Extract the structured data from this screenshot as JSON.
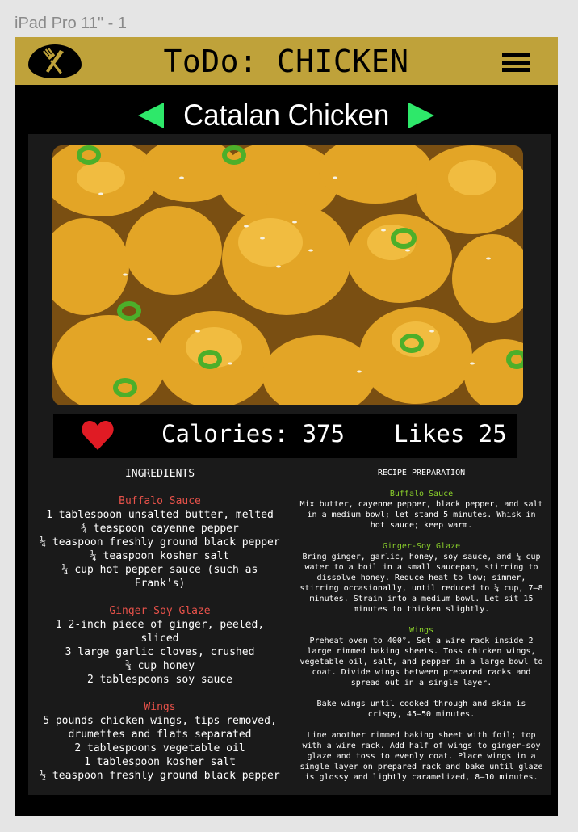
{
  "frame": {
    "label": "iPad Pro 11\" - 1"
  },
  "header": {
    "title": "ToDo: CHICKEN",
    "logo_icon": "fork-knife-icon",
    "menu_icon": "hamburger-menu-icon"
  },
  "colors": {
    "header_bg": "#bfa23a",
    "arrow": "#2ee86a",
    "heart": "#e01b24",
    "ingredient_section": "#e8524a",
    "prep_section": "#8bd12b"
  },
  "nav": {
    "recipe_title": "Catalan Chicken",
    "prev_icon": "left-arrow-icon",
    "next_icon": "right-arrow-icon"
  },
  "stats": {
    "heart_icon": "heart-icon",
    "calories": "Calories: 375",
    "likes": "Likes 25"
  },
  "ingredients": {
    "heading": "INGREDIENTS",
    "sections": [
      {
        "title": "Buffalo Sauce",
        "items": [
          "1 tablespoon unsalted butter, melted",
          "¾ teaspoon cayenne pepper",
          "¼ teaspoon freshly ground black pepper",
          "¼ teaspoon kosher salt",
          "¼ cup hot pepper sauce (such as Frank's)"
        ]
      },
      {
        "title": "Ginger-Soy Glaze",
        "items": [
          "1 2-inch piece of ginger, peeled, sliced",
          "3 large garlic cloves, crushed",
          "¾ cup honey",
          "2 tablespoons soy sauce"
        ]
      },
      {
        "title": "Wings",
        "items": [
          "5 pounds chicken wings, tips removed, drumettes and flats separated",
          "2 tablespoons vegetable oil",
          "1 tablespoon kosher salt",
          "½ teaspoon freshly ground black pepper"
        ]
      }
    ]
  },
  "preparation": {
    "heading": "RECIPE PREPARATION",
    "sections": [
      {
        "title": "Buffalo Sauce",
        "paragraphs": [
          "Mix butter, cayenne pepper, black pepper, and salt in a medium bowl; let stand 5 minutes. Whisk in hot sauce; keep warm."
        ]
      },
      {
        "title": "Ginger-Soy Glaze",
        "paragraphs": [
          "Bring ginger, garlic, honey, soy sauce, and ¼ cup water to a boil in a small saucepan, stirring to dissolve honey. Reduce heat to low; simmer, stirring occasionally, until reduced to ¼ cup, 7–8 minutes. Strain into a medium bowl. Let sit 15 minutes to thicken slightly."
        ]
      },
      {
        "title": "Wings",
        "paragraphs": [
          "Preheat oven to 400°. Set a wire rack inside 2 large rimmed baking sheets. Toss chicken wings, vegetable oil, salt, and pepper in a large bowl to coat. Divide wings between prepared racks and spread out in a single layer.",
          "Bake wings until cooked through and skin is crispy, 45–50 minutes.",
          "Line another rimmed baking sheet with foil; top with a wire rack. Add half of wings to ginger-soy glaze and toss to evenly coat. Place wings in a single layer on prepared rack and bake until glaze is glossy and lightly caramelized, 8–10 minutes."
        ]
      }
    ]
  }
}
